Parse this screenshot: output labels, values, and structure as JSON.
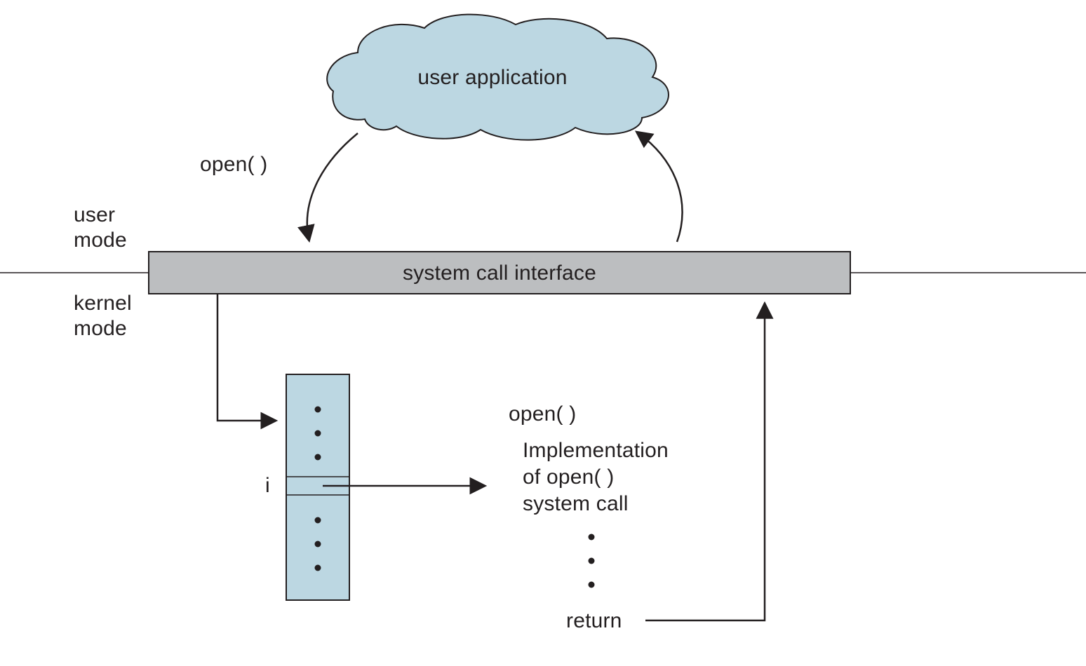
{
  "diagram": {
    "cloud_label": "user application",
    "call_label": "open( )",
    "mode_upper": "user",
    "mode_upper2": "mode",
    "mode_lower": "kernel",
    "mode_lower2": "mode",
    "interface_label": "system call interface",
    "table_index_label": "i",
    "impl_header": "open( )",
    "impl_line1": "Implementation",
    "impl_line2": "of open( )",
    "impl_line3": "system call",
    "return_label": "return"
  }
}
